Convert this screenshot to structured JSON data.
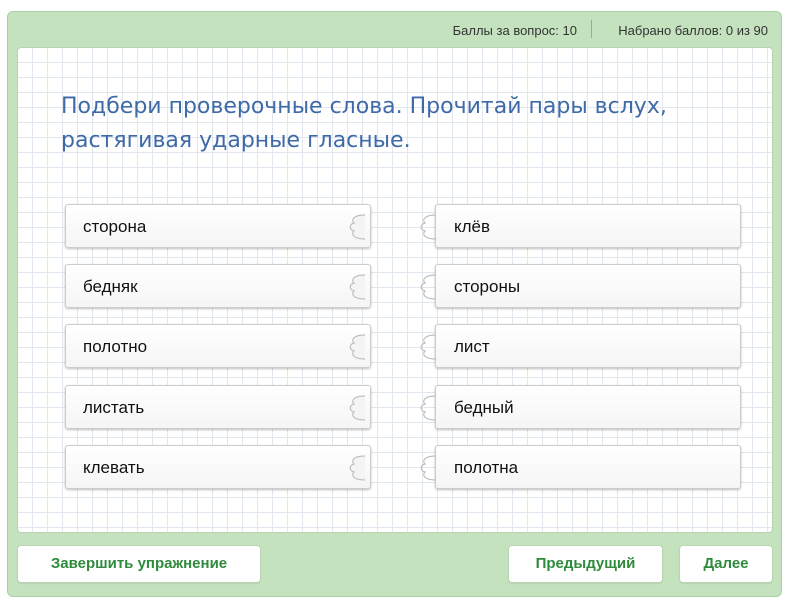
{
  "header": {
    "points_per_question": "Баллы за вопрос: 10",
    "points_total": "Набрано баллов: 0 из 90"
  },
  "task": {
    "text": "Подбери проверочные слова. Прочитай пары вслух, растягивая ударные гласные."
  },
  "left_words": [
    "сторона",
    "бедняк",
    "полотно",
    "листать",
    "клевать"
  ],
  "right_words": [
    "клёв",
    "стороны",
    "лист",
    "бедный",
    "полотна"
  ],
  "buttons": {
    "finish": "Завершить упражнение",
    "previous": "Предыдущий",
    "next": "Далее"
  },
  "colors": {
    "frame": "#c5e2bf",
    "task_text": "#3f6aa8",
    "button_text": "#2e8b3c"
  }
}
